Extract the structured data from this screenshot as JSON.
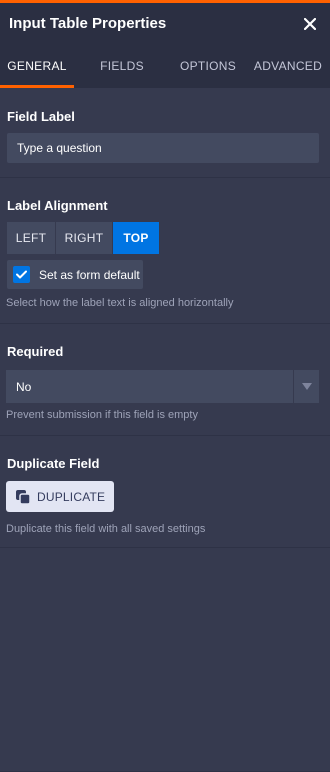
{
  "header": {
    "title": "Input Table Properties",
    "close_icon": "close-icon",
    "accent_color": "#ff6100"
  },
  "tabs": [
    {
      "label": "GENERAL",
      "active": true
    },
    {
      "label": "FIELDS",
      "active": false
    },
    {
      "label": "OPTIONS",
      "active": false
    },
    {
      "label": "ADVANCED",
      "active": false
    }
  ],
  "field_label": {
    "title": "Field Label",
    "value": "Type a question"
  },
  "label_alignment": {
    "title": "Label Alignment",
    "options": [
      "LEFT",
      "RIGHT",
      "TOP"
    ],
    "selected": "TOP",
    "checkbox_label": "Set as form default",
    "checkbox_checked": true,
    "help": "Select how the label text is aligned horizontally"
  },
  "required": {
    "title": "Required",
    "value": "No",
    "help": "Prevent submission if this field is empty"
  },
  "duplicate": {
    "title": "Duplicate Field",
    "button_label": "DUPLICATE",
    "icon": "duplicate-icon",
    "help": "Duplicate this field with all saved settings"
  },
  "colors": {
    "panel_bg": "#363a4f",
    "header_bg": "#2b2f42",
    "input_bg": "#434a60",
    "selected_blue": "#0075e3"
  }
}
